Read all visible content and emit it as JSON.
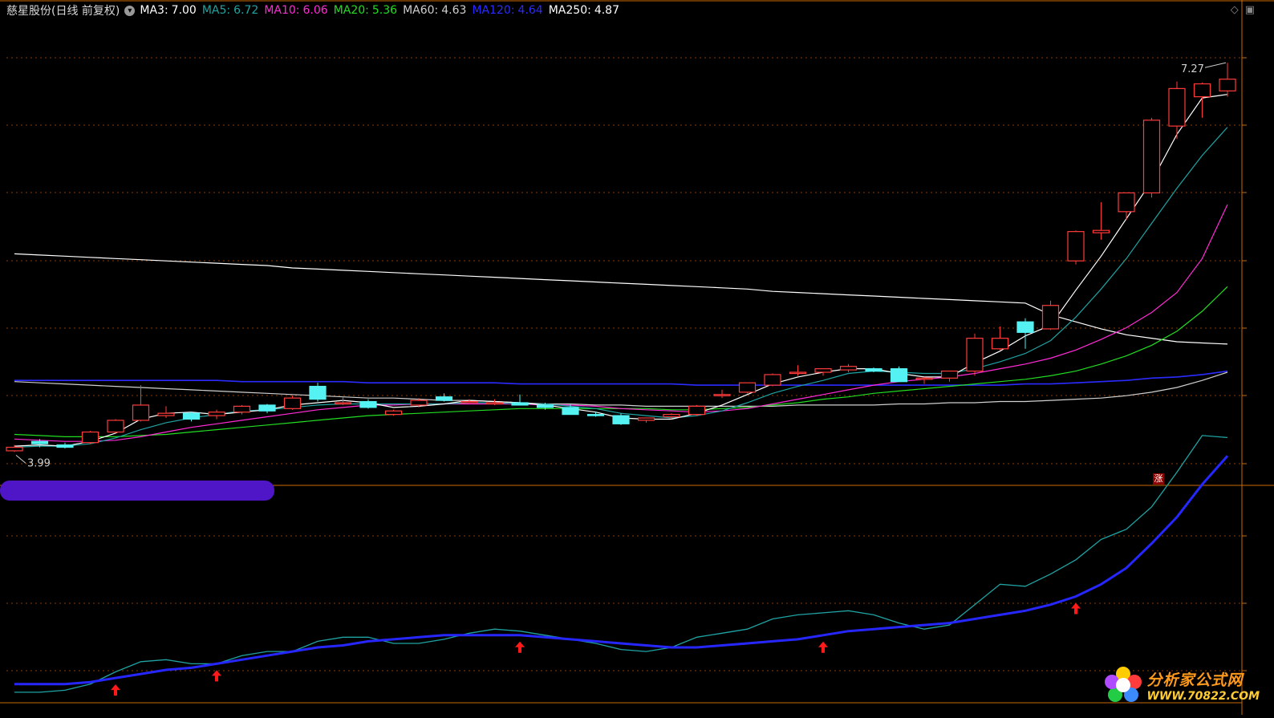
{
  "header": {
    "title": "慈星股份(日线 前复权)",
    "toggle_icon": "circle-chevron-icon",
    "ma": [
      {
        "label": "MA3",
        "value": "7.00",
        "color": "#ffffff"
      },
      {
        "label": "MA5",
        "value": "6.72",
        "color": "#1fa3a3"
      },
      {
        "label": "MA10",
        "value": "6.06",
        "color": "#ff2bd6"
      },
      {
        "label": "MA20",
        "value": "5.36",
        "color": "#22dd22"
      },
      {
        "label": "MA60",
        "value": "4.63",
        "color": "#cfcfcf"
      },
      {
        "label": "MA120",
        "value": "4.64",
        "color": "#2b2bff"
      },
      {
        "label": "MA250",
        "value": "4.87",
        "color": "#ffffff"
      }
    ]
  },
  "annotations": {
    "high": "7.27",
    "low": "3.99",
    "badge": "涨"
  },
  "watermark": {
    "line1": "分析家公式网",
    "line2": "WWW.70822.COM"
  },
  "colors": {
    "up": "#ff3b3b",
    "down": "#54f2f2",
    "grid": "#8a3a00",
    "divider": "#c96a00"
  },
  "chart_data": [
    {
      "type": "candlestick",
      "title": "慈星股份(日线 前复权)",
      "ylim": [
        3.85,
        7.6
      ],
      "ohlc": [
        [
          3.96,
          4.01,
          3.95,
          3.99
        ],
        [
          4.04,
          4.06,
          3.99,
          4.02
        ],
        [
          4.01,
          4.03,
          3.98,
          3.99
        ],
        [
          4.03,
          4.13,
          4.02,
          4.12
        ],
        [
          4.12,
          4.23,
          4.11,
          4.22
        ],
        [
          4.22,
          4.52,
          4.21,
          4.35
        ],
        [
          4.26,
          4.34,
          4.24,
          4.28
        ],
        [
          4.28,
          4.29,
          4.21,
          4.23
        ],
        [
          4.26,
          4.31,
          4.23,
          4.29
        ],
        [
          4.29,
          4.35,
          4.27,
          4.34
        ],
        [
          4.35,
          4.36,
          4.28,
          4.3
        ],
        [
          4.32,
          4.43,
          4.31,
          4.41
        ],
        [
          4.51,
          4.54,
          4.38,
          4.4
        ],
        [
          4.37,
          4.42,
          4.35,
          4.37
        ],
        [
          4.38,
          4.4,
          4.32,
          4.33
        ],
        [
          4.27,
          4.31,
          4.26,
          4.3
        ],
        [
          4.35,
          4.41,
          4.33,
          4.39
        ],
        [
          4.42,
          4.45,
          4.38,
          4.39
        ],
        [
          4.38,
          4.4,
          4.37,
          4.38
        ],
        [
          4.36,
          4.4,
          4.35,
          4.37
        ],
        [
          4.37,
          4.44,
          4.36,
          4.35
        ],
        [
          4.35,
          4.37,
          4.31,
          4.33
        ],
        [
          4.33,
          4.36,
          4.31,
          4.27
        ],
        [
          4.27,
          4.29,
          4.25,
          4.26
        ],
        [
          4.26,
          4.28,
          4.18,
          4.19
        ],
        [
          4.22,
          4.24,
          4.2,
          4.24
        ],
        [
          4.25,
          4.28,
          4.23,
          4.27
        ],
        [
          4.27,
          4.35,
          4.26,
          4.34
        ],
        [
          4.43,
          4.48,
          4.41,
          4.44
        ],
        [
          4.46,
          4.51,
          4.45,
          4.54
        ],
        [
          4.52,
          4.62,
          4.51,
          4.61
        ],
        [
          4.62,
          4.69,
          4.6,
          4.63
        ],
        [
          4.63,
          4.66,
          4.6,
          4.66
        ],
        [
          4.65,
          4.7,
          4.63,
          4.68
        ],
        [
          4.66,
          4.67,
          4.63,
          4.64
        ],
        [
          4.66,
          4.68,
          4.58,
          4.55
        ],
        [
          4.57,
          4.59,
          4.53,
          4.58
        ],
        [
          4.58,
          4.61,
          4.55,
          4.64
        ],
        [
          4.64,
          4.96,
          4.6,
          4.92
        ],
        [
          4.83,
          5.02,
          4.82,
          4.92
        ],
        [
          5.06,
          5.09,
          4.83,
          4.97
        ],
        [
          5.0,
          5.24,
          4.99,
          5.2
        ],
        [
          5.58,
          5.84,
          5.55,
          5.83
        ],
        [
          5.82,
          6.08,
          5.76,
          5.84
        ],
        [
          6.0,
          6.15,
          5.93,
          6.16
        ],
        [
          6.16,
          6.8,
          6.12,
          6.78
        ],
        [
          6.73,
          7.11,
          6.62,
          7.05
        ],
        [
          6.98,
          7.1,
          6.8,
          7.09
        ],
        [
          7.03,
          7.27,
          6.98,
          7.13
        ]
      ],
      "series": [
        {
          "name": "MA3",
          "values": [
            4.0,
            4.01,
            4.0,
            4.04,
            4.11,
            4.23,
            4.28,
            4.29,
            4.27,
            4.29,
            4.31,
            4.35,
            4.37,
            4.39,
            4.37,
            4.33,
            4.34,
            4.36,
            4.39,
            4.38,
            4.37,
            4.35,
            4.32,
            4.29,
            4.24,
            4.23,
            4.23,
            4.28,
            4.35,
            4.44,
            4.53,
            4.59,
            4.63,
            4.66,
            4.66,
            4.62,
            4.59,
            4.59,
            4.71,
            4.81,
            4.94,
            5.03,
            5.33,
            5.62,
            5.94,
            6.26,
            6.66,
            6.97,
            7.0
          ]
        },
        {
          "name": "MA5",
          "values": [
            3.99,
            4.0,
            4.0,
            4.02,
            4.07,
            4.14,
            4.2,
            4.24,
            4.27,
            4.3,
            4.31,
            4.33,
            4.35,
            4.36,
            4.36,
            4.36,
            4.36,
            4.36,
            4.37,
            4.37,
            4.36,
            4.36,
            4.34,
            4.32,
            4.28,
            4.26,
            4.24,
            4.26,
            4.3,
            4.37,
            4.45,
            4.51,
            4.56,
            4.62,
            4.64,
            4.63,
            4.62,
            4.62,
            4.66,
            4.72,
            4.79,
            4.9,
            5.1,
            5.34,
            5.6,
            5.9,
            6.2,
            6.48,
            6.72
          ]
        },
        {
          "name": "MA10",
          "values": [
            4.06,
            4.05,
            4.04,
            4.04,
            4.05,
            4.08,
            4.12,
            4.16,
            4.19,
            4.22,
            4.25,
            4.28,
            4.31,
            4.33,
            4.35,
            4.35,
            4.36,
            4.36,
            4.36,
            4.36,
            4.36,
            4.35,
            4.35,
            4.34,
            4.32,
            4.31,
            4.3,
            4.29,
            4.3,
            4.32,
            4.36,
            4.4,
            4.44,
            4.48,
            4.52,
            4.55,
            4.57,
            4.59,
            4.62,
            4.66,
            4.7,
            4.75,
            4.82,
            4.91,
            5.01,
            5.14,
            5.31,
            5.6,
            6.06
          ]
        },
        {
          "name": "MA20",
          "values": [
            4.1,
            4.09,
            4.08,
            4.08,
            4.08,
            4.09,
            4.1,
            4.12,
            4.14,
            4.16,
            4.18,
            4.2,
            4.22,
            4.24,
            4.26,
            4.27,
            4.28,
            4.29,
            4.3,
            4.31,
            4.32,
            4.32,
            4.32,
            4.32,
            4.32,
            4.32,
            4.31,
            4.31,
            4.32,
            4.33,
            4.35,
            4.37,
            4.4,
            4.42,
            4.45,
            4.47,
            4.49,
            4.51,
            4.53,
            4.55,
            4.57,
            4.6,
            4.64,
            4.7,
            4.77,
            4.86,
            4.98,
            5.15,
            5.36
          ]
        },
        {
          "name": "MA60",
          "values": [
            4.55,
            4.54,
            4.53,
            4.52,
            4.51,
            4.5,
            4.49,
            4.48,
            4.47,
            4.46,
            4.45,
            4.44,
            4.43,
            4.42,
            4.41,
            4.41,
            4.4,
            4.39,
            4.39,
            4.38,
            4.37,
            4.36,
            4.36,
            4.35,
            4.35,
            4.34,
            4.34,
            4.34,
            4.34,
            4.34,
            4.34,
            4.35,
            4.35,
            4.35,
            4.35,
            4.36,
            4.36,
            4.37,
            4.37,
            4.38,
            4.38,
            4.39,
            4.4,
            4.41,
            4.43,
            4.46,
            4.5,
            4.56,
            4.63
          ]
        },
        {
          "name": "MA120",
          "values": [
            4.56,
            4.56,
            4.56,
            4.56,
            4.56,
            4.56,
            4.56,
            4.56,
            4.56,
            4.55,
            4.55,
            4.55,
            4.55,
            4.55,
            4.54,
            4.54,
            4.54,
            4.54,
            4.54,
            4.54,
            4.53,
            4.53,
            4.53,
            4.53,
            4.53,
            4.53,
            4.53,
            4.52,
            4.52,
            4.52,
            4.52,
            4.52,
            4.52,
            4.52,
            4.52,
            4.52,
            4.52,
            4.52,
            4.52,
            4.52,
            4.53,
            4.53,
            4.54,
            4.55,
            4.56,
            4.58,
            4.59,
            4.61,
            4.64
          ]
        },
        {
          "name": "MA250",
          "values": [
            5.64,
            5.63,
            5.62,
            5.61,
            5.6,
            5.59,
            5.58,
            5.57,
            5.56,
            5.55,
            5.54,
            5.52,
            5.51,
            5.5,
            5.49,
            5.48,
            5.47,
            5.46,
            5.45,
            5.44,
            5.43,
            5.42,
            5.41,
            5.4,
            5.39,
            5.38,
            5.37,
            5.36,
            5.35,
            5.34,
            5.32,
            5.31,
            5.3,
            5.29,
            5.28,
            5.27,
            5.26,
            5.25,
            5.24,
            5.23,
            5.22,
            5.12,
            5.06,
            5.0,
            4.95,
            4.92,
            4.89,
            4.88,
            4.87
          ]
        }
      ]
    },
    {
      "type": "line",
      "ylim": [
        0,
        100
      ],
      "series": [
        {
          "values": [
            2,
            2,
            3,
            6,
            12,
            17,
            18,
            16,
            16,
            20,
            22,
            22,
            27,
            29,
            29,
            26,
            26,
            28,
            31,
            33,
            32,
            30,
            28,
            26,
            23,
            22,
            24,
            29,
            31,
            33,
            38,
            40,
            41,
            42,
            40,
            36,
            33,
            35,
            45,
            55,
            54,
            60,
            67,
            77,
            82,
            93,
            110,
            128,
            127
          ]
        },
        {
          "values": [
            6,
            6,
            6,
            7,
            9,
            11,
            13,
            14,
            16,
            18,
            20,
            22,
            24,
            25,
            27,
            28,
            29,
            30,
            30,
            30,
            30,
            29,
            28,
            27,
            26,
            25,
            24,
            24,
            25,
            26,
            27,
            28,
            30,
            32,
            33,
            34,
            35,
            36,
            38,
            40,
            42,
            45,
            49,
            55,
            63,
            75,
            88,
            104,
            118
          ]
        }
      ],
      "arrow_indices": [
        4,
        8,
        20,
        32,
        42
      ]
    }
  ]
}
